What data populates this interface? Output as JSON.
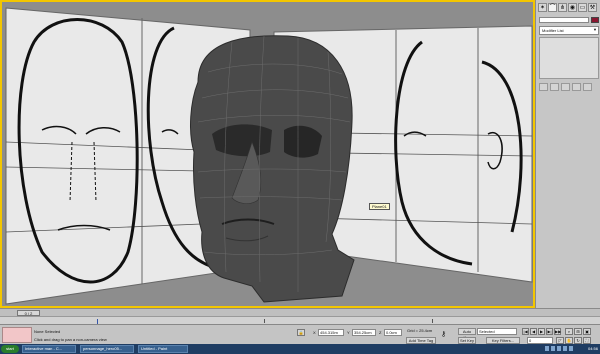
{
  "viewport": {
    "object_label": "Plane01",
    "active_border_color": "#f3c600"
  },
  "command_panel": {
    "tabs": [
      "create-icon",
      "modify-icon",
      "hierarchy-icon",
      "motion-icon",
      "display-icon",
      "utilities-icon"
    ],
    "modifier_list_label": "Modifier List",
    "object_color": "#8a1630"
  },
  "timeline": {
    "slider_label": "0 / 2",
    "current_frame": 0,
    "total_frames": 2
  },
  "status": {
    "selection_text": "None Selected",
    "prompt_text": "Click and drag to pan a non-camera view",
    "x_value": "454.315m",
    "y_value": "354.25cm",
    "z_value": "0.0cm",
    "grid_text": "Grid = 25.4cm",
    "add_time_tag": "Add Time Tag",
    "auto_key": "Auto Key",
    "set_key": "Set Key",
    "selected_option": "Selected",
    "key_filters": "Key Filters...",
    "frame_value": "0"
  },
  "taskbar": {
    "start_label": "start",
    "tasks": [
      "Interactive man - C...",
      "personnage_hero05...",
      "Untitled - Paint"
    ],
    "clock": "04:56"
  }
}
